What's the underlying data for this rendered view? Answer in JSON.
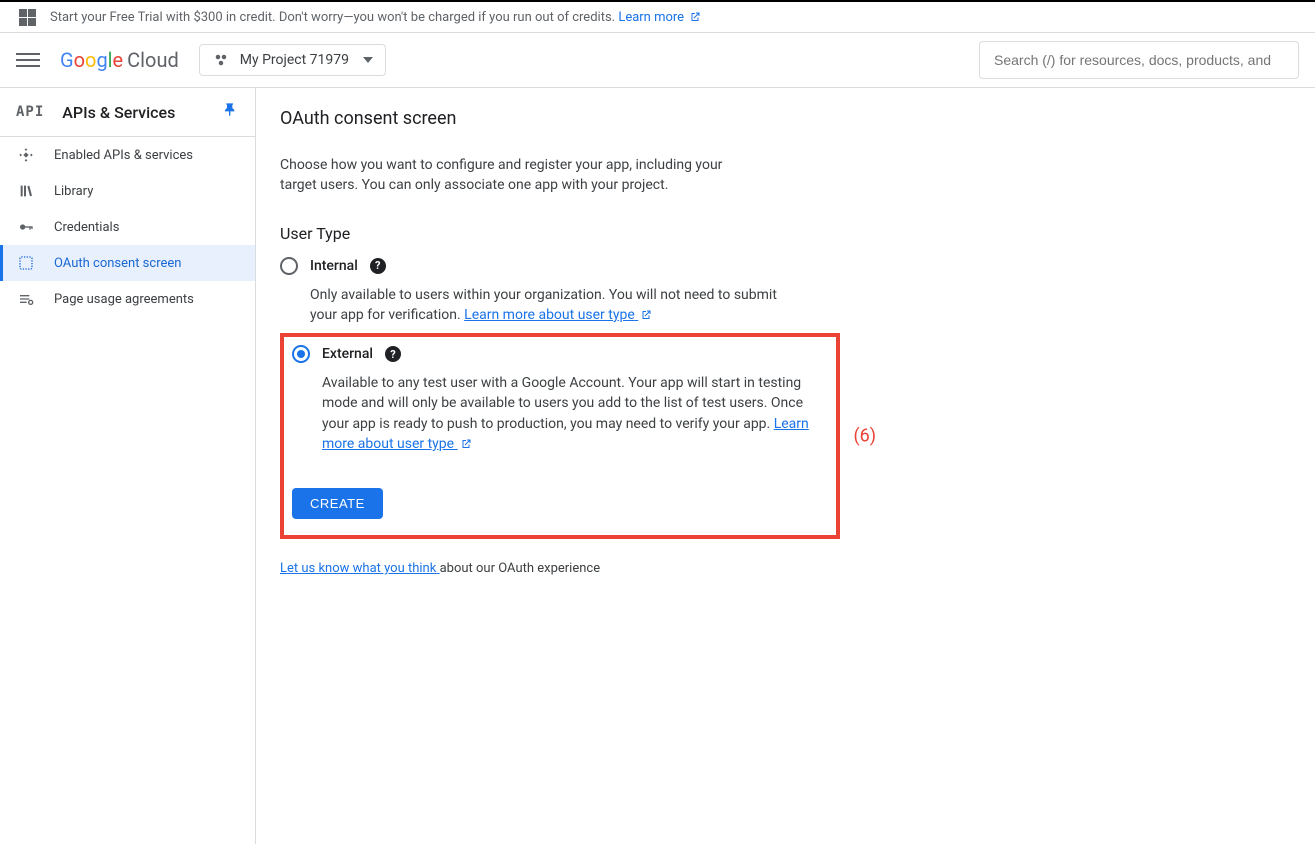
{
  "trial": {
    "text_prefix": "Start your Free Trial with $300 in credit. Don't worry—you won't be charged if you run out of credits. ",
    "learn_more": "Learn more"
  },
  "header": {
    "cloud_label": "Cloud",
    "project_name": "My Project 71979",
    "search_placeholder": "Search (/) for resources, docs, products, and"
  },
  "sidebar": {
    "api_badge": "API",
    "title": "APIs & Services",
    "items": [
      {
        "label": "Enabled APIs & services"
      },
      {
        "label": "Library"
      },
      {
        "label": "Credentials"
      },
      {
        "label": "OAuth consent screen"
      },
      {
        "label": "Page usage agreements"
      }
    ]
  },
  "main": {
    "page_title": "OAuth consent screen",
    "intro": "Choose how you want to configure and register your app, including your target users. You can only associate one app with your project.",
    "user_type_heading": "User Type",
    "internal": {
      "label": "Internal",
      "desc": "Only available to users within your organization. You will not need to submit your app for verification. ",
      "learn_more": "Learn more about user type"
    },
    "external": {
      "label": "External",
      "desc": "Available to any test user with a Google Account. Your app will start in testing mode and will only be available to users you add to the list of test users. Once your app is ready to push to production, you may need to verify your app. ",
      "learn_more": "Learn more about user type"
    },
    "create_label": "CREATE",
    "highlight_label": "(6)",
    "feedback_link": "Let us know what you think",
    "feedback_suffix": " about our OAuth experience"
  }
}
